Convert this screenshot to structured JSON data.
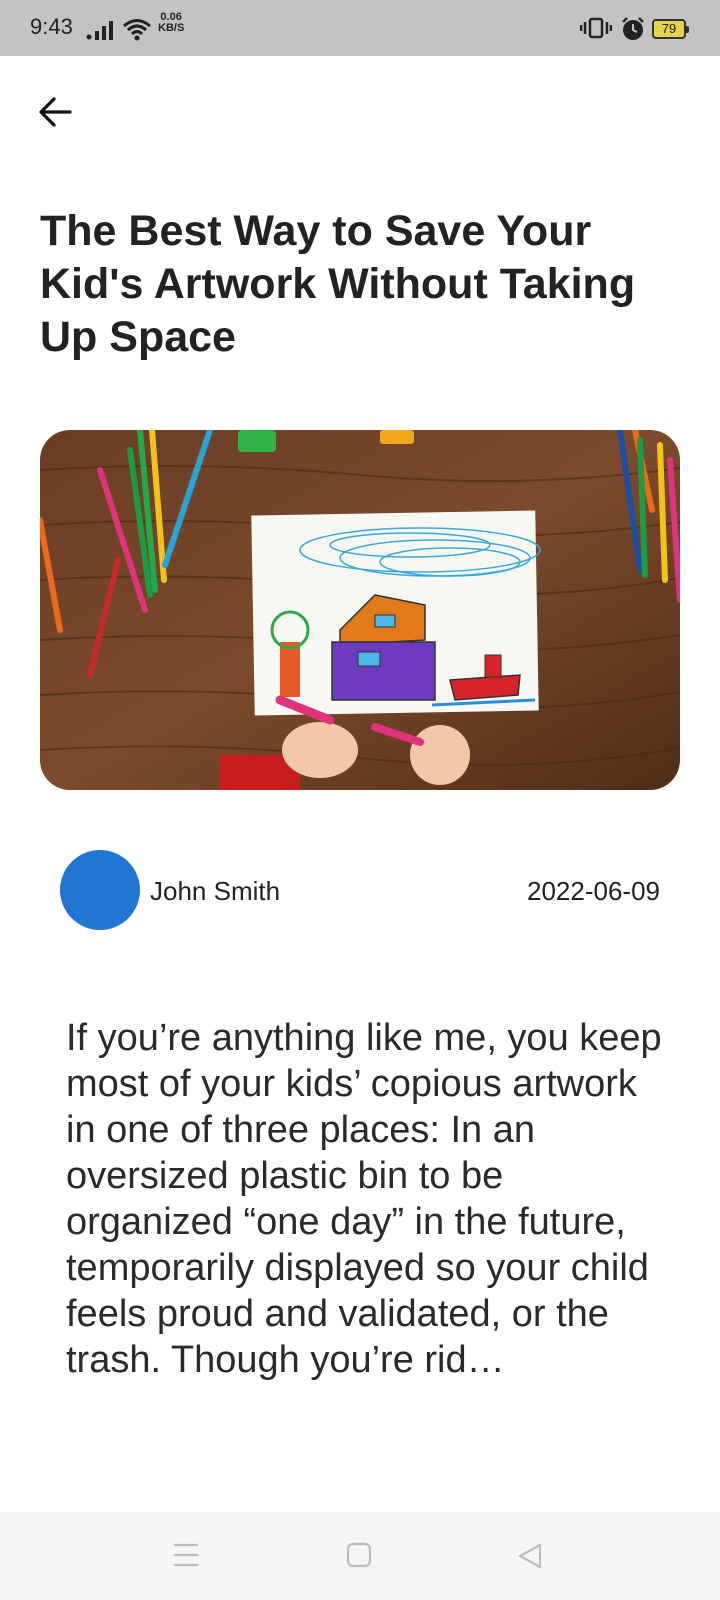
{
  "status_bar": {
    "time": "9:43",
    "net_speed_value": "0.06",
    "net_speed_unit": "KB/S",
    "battery": "79"
  },
  "article": {
    "title": "The Best Way to Save Your Kid's Artwork Without Taking Up Space",
    "author": "John Smith",
    "date": "2022-06-09",
    "excerpt": "If you’re anything like me, you keep most of your kids’ copious artwork in one of three places: In an oversized plastic bin to be organized “one day” in the future, temporarily displayed so your child feels proud and validated, or the trash. Though you’re rid…",
    "avatar_color": "#1f75d1"
  },
  "icons": {
    "back": "arrow-left-icon",
    "nav_menu": "menu-icon",
    "nav_home": "square-icon",
    "nav_back": "triangle-back-icon"
  }
}
